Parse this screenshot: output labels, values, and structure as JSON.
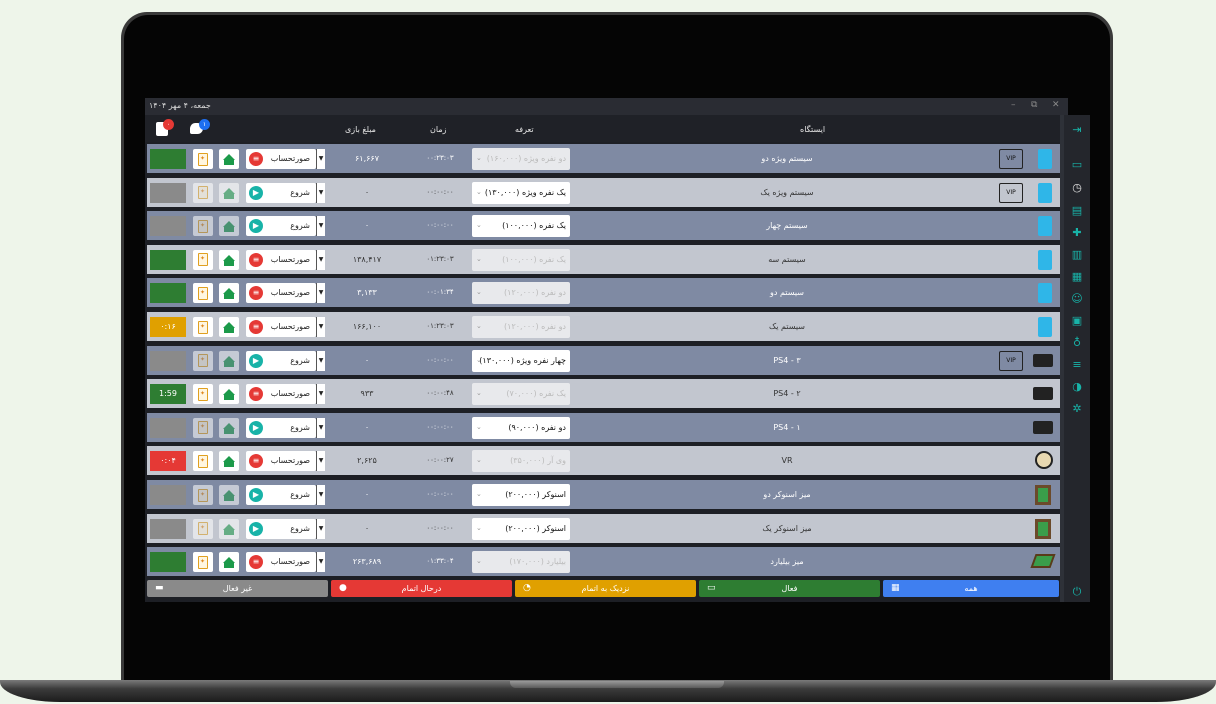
{
  "titlebar": {
    "date": "جمعه، ۴ مهر ۱۴۰۴",
    "minimize": "–",
    "restore": "⧉",
    "close": "✕"
  },
  "header": {
    "badge_red": "۰",
    "badge_blue": "۱",
    "amount": "مبلغ بازی",
    "time": "زمان",
    "tariff": "تعرفه",
    "station": "ایستگاه"
  },
  "rows": [
    {
      "station": "سیستم ویژه دو",
      "tariff": "دو نفره ویژه (۱۶۰,۰۰۰)",
      "time": "۰۰:۲۳:۰۳",
      "amount": "۶۱,۶۶۷",
      "action": "صورتحساب",
      "status": ""
    },
    {
      "station": "سیستم ویژه یک",
      "tariff": "یک نفره ویژه (۱۳۰,۰۰۰)",
      "time": "۰۰:۰۰:۰۰",
      "amount": "۰",
      "action": "شروع",
      "status": ""
    },
    {
      "station": "سیستم چهار",
      "tariff": "یک نفره (۱۰۰,۰۰۰)",
      "time": "۰۰:۰۰:۰۰",
      "amount": "۰",
      "action": "شروع",
      "status": ""
    },
    {
      "station": "سیستم سه",
      "tariff": "یک نفره (۱۰۰,۰۰۰)",
      "time": "۰۱:۲۳:۰۳",
      "amount": "۱۳۸,۴۱۷",
      "action": "صورتحساب",
      "status": ""
    },
    {
      "station": "سیستم دو",
      "tariff": "دو نفره (۱۲۰,۰۰۰)",
      "time": "۰۰:۰۱:۳۴",
      "amount": "۳,۱۳۳",
      "action": "صورتحساب",
      "status": ""
    },
    {
      "station": "سیستم یک",
      "tariff": "دو نفره (۱۲۰,۰۰۰)",
      "time": "۰۱:۲۳:۰۳",
      "amount": "۱۶۶,۱۰۰",
      "action": "صورتحساب",
      "status": "۰:۱۶"
    },
    {
      "station": "PS4 - ۳",
      "tariff": "چهار نفره ویژه (۱۳۰,۰۰۰)",
      "time": "۰۰:۰۰:۰۰",
      "amount": "۰",
      "action": "شروع",
      "status": ""
    },
    {
      "station": "PS4 - ۲",
      "tariff": "یک نفره (۷۰,۰۰۰)",
      "time": "۰۰:۰۰:۴۸",
      "amount": "۹۳۳",
      "action": "صورتحساب",
      "status": "1:59"
    },
    {
      "station": "PS4 - ۱",
      "tariff": "دو نفره (۹۰,۰۰۰)",
      "time": "۰۰:۰۰:۰۰",
      "amount": "۰",
      "action": "شروع",
      "status": ""
    },
    {
      "station": "VR",
      "tariff": "وی آر (۳۵۰,۰۰۰)",
      "time": "۰۰:۰۰:۲۷",
      "amount": "۲,۶۲۵",
      "action": "صورتحساب",
      "status": "۰:۰۴"
    },
    {
      "station": "میز اسنوکر دو",
      "tariff": "اسنوکر (۲۰۰,۰۰۰)",
      "time": "۰۰:۰۰:۰۰",
      "amount": "۰",
      "action": "شروع",
      "status": ""
    },
    {
      "station": "میز اسنوکر یک",
      "tariff": "اسنوکر (۲۰۰,۰۰۰)",
      "time": "۰۰:۰۰:۰۰",
      "amount": "۰",
      "action": "شروع",
      "status": ""
    },
    {
      "station": "میز بیلیارد",
      "tariff": "بیلیارد (۱۷۰,۰۰۰)",
      "time": "۰۱:۳۳:۰۴",
      "amount": "۲۶۳,۶۸۹",
      "action": "صورتحساب",
      "status": ""
    }
  ],
  "vip_label": "VIP",
  "footer": {
    "inactive": "غیر فعال",
    "in_progress": "درحال اتمام",
    "near_end": "نزدیک به اتمام",
    "active": "فعال",
    "all": "همه"
  },
  "colors": {
    "green": "#2e7d32",
    "gray": "#8a8a8a",
    "orange": "#e0a000",
    "red": "#e53935",
    "blue": "#3f7ff0",
    "accent": "#18b3a8"
  }
}
